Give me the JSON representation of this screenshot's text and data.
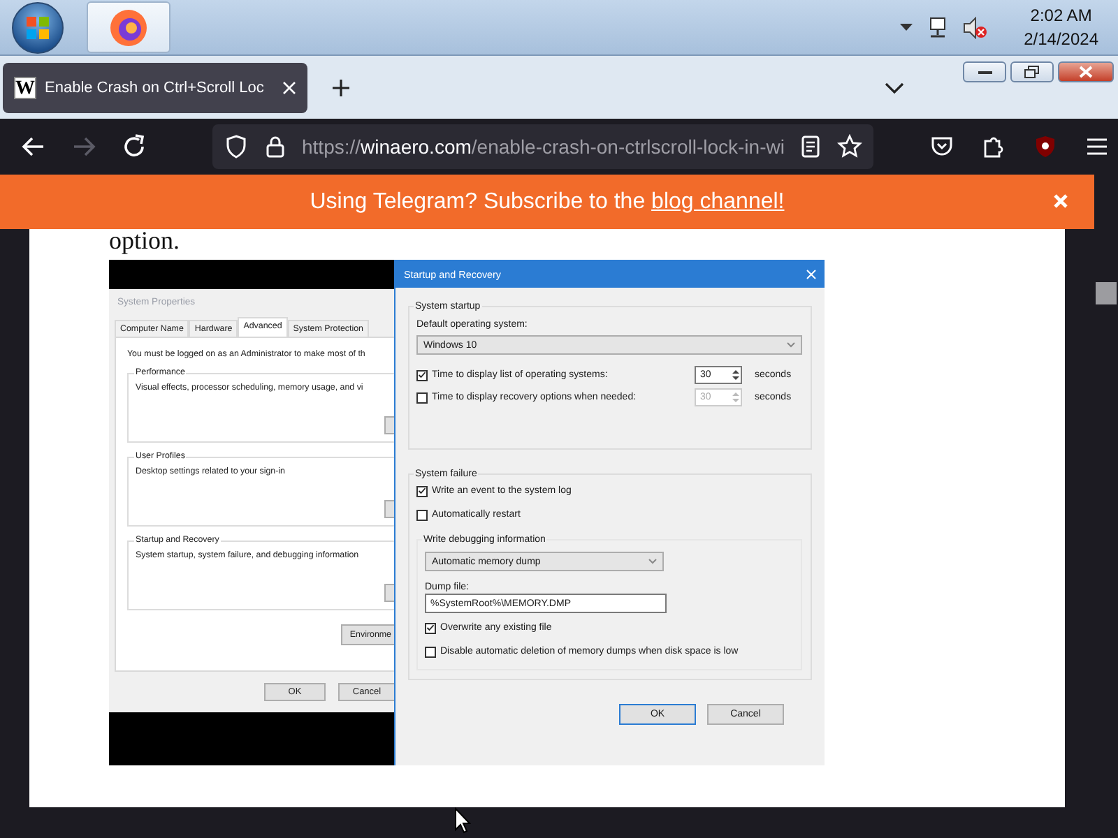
{
  "taskbar": {
    "clock_time": "2:02 AM",
    "clock_date": "2/14/2024"
  },
  "tab": {
    "favicon_letter": "W",
    "title": "Enable Crash on Ctrl+Scroll Loc",
    "selected": true
  },
  "nav_buttons": [
    {
      "kind": "back",
      "disabled": false
    },
    {
      "kind": "forward",
      "disabled": true
    },
    {
      "kind": "reload",
      "disabled": false
    }
  ],
  "url": {
    "scheme": "https://",
    "host": "winaero.com",
    "path": "/enable-crash-on-ctrlscroll-lock-in-wi"
  },
  "banner": {
    "text": "Using Telegram? Subscribe to the",
    "link": "blog channel!"
  },
  "article": {
    "text": "option.",
    "screenshot": {
      "system_properties": {
        "title": "System Properties",
        "tabs": [
          {
            "label": "Computer Name",
            "selected": false
          },
          {
            "label": "Hardware",
            "selected": false
          },
          {
            "label": "Advanced",
            "selected": true
          },
          {
            "label": "System Protection",
            "selected": false
          }
        ],
        "notice": "You must be logged on as an Administrator to make most of th",
        "groups": [
          {
            "title": "Performance",
            "description": "Visual effects, processor scheduling, memory usage, and vi"
          },
          {
            "title": "User Profiles",
            "description": "Desktop settings related to your sign-in"
          },
          {
            "title": "Startup and Recovery",
            "description": "System startup, system failure, and debugging information"
          }
        ],
        "environment_button": "Environme",
        "buttons": [
          "OK",
          "Cancel"
        ]
      },
      "startup_recovery": {
        "title": "Startup and Recovery",
        "system_startup": {
          "title": "System startup",
          "default_os_label": "Default operating system:",
          "default_os": "Windows 10",
          "timeouts": [
            {
              "label": "Time to display list of operating systems:",
              "checked": true,
              "value": "30",
              "unit": "seconds",
              "disabled": false
            },
            {
              "label": "Time to display recovery options when needed:",
              "checked": false,
              "value": "30",
              "unit": "seconds",
              "disabled": true
            }
          ]
        },
        "system_failure": {
          "title": "System failure",
          "options": [
            {
              "label": "Write an event to the system log",
              "checked": true
            },
            {
              "label": "Automatically restart",
              "checked": false
            }
          ],
          "debug": {
            "title": "Write debugging information",
            "dump_type": "Automatic memory dump",
            "dump_file_label": "Dump file:",
            "dump_file": "%SystemRoot%\\MEMORY.DMP",
            "options": [
              {
                "label": "Overwrite any existing file",
                "checked": true
              },
              {
                "label": "Disable automatic deletion of memory dumps when disk space is low",
                "checked": false
              }
            ]
          }
        },
        "buttons": [
          {
            "label": "OK",
            "default": true
          },
          {
            "label": "Cancel",
            "default": false
          }
        ]
      }
    }
  }
}
